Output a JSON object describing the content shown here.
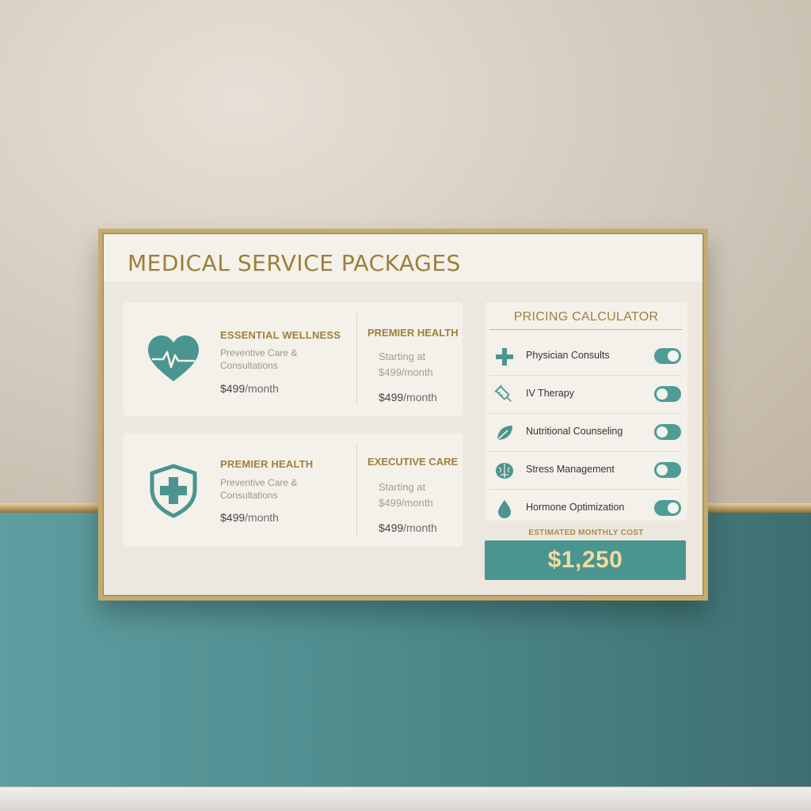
{
  "header": {
    "title": "MEDICAL SERVICE PACKAGES"
  },
  "packages": [
    {
      "icon": "heart-pulse-icon",
      "name": "ESSENTIAL WELLNESS",
      "description": "Preventive Care & Consultations",
      "price": "$499",
      "price_unit": "/month",
      "side": {
        "name": "PREMIER HEALTH",
        "starting": "Starting at $499/month",
        "price": "$499",
        "price_unit": "/month"
      }
    },
    {
      "icon": "shield-cross-icon",
      "name": "PREMIER HEALTH",
      "description": "Preventive Care & Consultations",
      "price": "$499",
      "price_unit": "/month",
      "side": {
        "name": "EXECUTIVE CARE",
        "starting": "Starting at $499/month",
        "price": "$499",
        "price_unit": "/month"
      }
    }
  ],
  "calculator": {
    "title": "PRICING CALCULATOR",
    "options": [
      {
        "icon": "medical-cross-icon",
        "label": "Physician Consults",
        "enabled": true
      },
      {
        "icon": "syringe-icon",
        "label": "IV Therapy",
        "enabled": false
      },
      {
        "icon": "leaf-icon",
        "label": "Nutritional Counseling",
        "enabled": false
      },
      {
        "icon": "brain-icon",
        "label": "Stress Management",
        "enabled": false
      },
      {
        "icon": "droplet-icon",
        "label": "Hormone Optimization",
        "enabled": true
      }
    ],
    "estimate_label": "ESTIMATED MONTHLY COST",
    "estimate_value": "$1,250"
  },
  "colors": {
    "accent_teal": "#4a958f",
    "accent_gold": "#a0803c",
    "estimate_text": "#f2dc9c"
  }
}
